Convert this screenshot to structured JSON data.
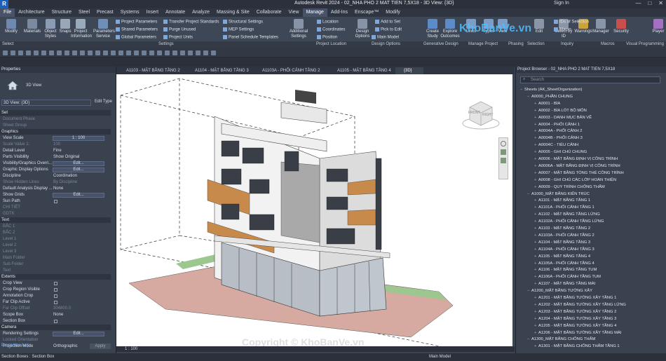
{
  "title": "Autodesk Revit 2024 - 02_NHA PHO 2 MAT TIEN 7,5X18 - 3D View: {3D}",
  "sign_in": "Sign In",
  "ribbon_tabs": [
    "File",
    "Architecture",
    "Structure",
    "Steel",
    "Precast",
    "Systems",
    "Insert",
    "Annotate",
    "Analyze",
    "Massing & Site",
    "Collaborate",
    "View",
    "Manage",
    "Add-Ins",
    "Enscape™",
    "Modify"
  ],
  "ribbon_big": [
    "Modify",
    "Materials",
    "Object Styles",
    "Snaps",
    "Project Information",
    "Parameters Service",
    "Additional Settings",
    "Design Options",
    "Create Study",
    "Explore Outcomes",
    "Links",
    "Types",
    "View",
    "Edit",
    "Select by ID",
    "Warnings",
    "Manager",
    "Security",
    "Player"
  ],
  "ribbon_small": [
    "Project Parameters",
    "Shared Parameters",
    "Global Parameters",
    "Transfer Project Standards",
    "Purge Unused",
    "Project Units",
    "Structural Settings",
    "MEP Settings",
    "Panel Schedule Templates",
    "Location",
    "Coordinates",
    "Position",
    "Add to Set",
    "Pick to Edit",
    "Main Model",
    "IDs of Selection",
    "Macro"
  ],
  "panels": [
    "Select",
    "Settings",
    "Project Location",
    "Design Options",
    "Generative Design",
    "Manage Project",
    "Phasing",
    "Selection",
    "Inquiry",
    "Macros",
    "Visual Programming"
  ],
  "props": {
    "header": "Properties",
    "type": "3D View",
    "selector": "3D View: {3D}",
    "edit_type": "Edit Type",
    "help": "Properties help",
    "apply": "Apply",
    "rows": [
      {
        "g": "Set"
      },
      {
        "k": "Document Phase",
        "v": "",
        "dim": true
      },
      {
        "k": "Sheet Group",
        "v": "",
        "dim": true
      },
      {
        "g": "Graphics"
      },
      {
        "k": "View Scale",
        "box": "1 : 100"
      },
      {
        "k": "Scale Value    1:",
        "v": "100",
        "dim": true
      },
      {
        "k": "Detail Level",
        "v": "Fine"
      },
      {
        "k": "Parts Visibility",
        "v": "Show Original"
      },
      {
        "k": "Visibility/Graphics Overri...",
        "box": "Edit..."
      },
      {
        "k": "Graphic Display Options",
        "box": "Edit..."
      },
      {
        "k": "Discipline",
        "v": "Coordination"
      },
      {
        "k": "Show Hidden Lines",
        "v": "By Discipline",
        "dim": true
      },
      {
        "k": "Default Analysis Display ...",
        "v": "None"
      },
      {
        "k": "Show Grids",
        "box": "Edit..."
      },
      {
        "k": "Sun Path",
        "cb": true
      },
      {
        "k": "CHI TIẾT",
        "v": "",
        "dim": true
      },
      {
        "k": "GDTK",
        "v": "",
        "dim": true
      },
      {
        "g": "Text"
      },
      {
        "k": "BẮC 1",
        "v": "",
        "dim": true
      },
      {
        "k": "BẮC 2",
        "v": "",
        "dim": true
      },
      {
        "k": "Level 1",
        "v": "",
        "dim": true
      },
      {
        "k": "Level 2",
        "v": "",
        "dim": true
      },
      {
        "k": "Level 3",
        "v": "",
        "dim": true
      },
      {
        "k": "Main Folder",
        "v": "",
        "dim": true
      },
      {
        "k": "Sub Folder",
        "v": "",
        "dim": true
      },
      {
        "k": "Text",
        "v": "",
        "dim": true
      },
      {
        "g": "Extents"
      },
      {
        "k": "Crop View",
        "cb": true
      },
      {
        "k": "Crop Region Visible",
        "cb": true
      },
      {
        "k": "Annotation Crop",
        "cb": true
      },
      {
        "k": "Far Clip Active",
        "cb": true
      },
      {
        "k": "Far Clip Offset",
        "v": "304800.0",
        "dim": true
      },
      {
        "k": "Scope Box",
        "v": "None"
      },
      {
        "k": "Section Box",
        "cb": true
      },
      {
        "g": "Camera"
      },
      {
        "k": "Rendering Settings",
        "box": "Edit..."
      },
      {
        "k": "Locked Orientation",
        "v": "",
        "dim": true
      },
      {
        "k": "Projection Mode",
        "v": "Orthographic"
      }
    ]
  },
  "view_tabs": [
    "A1103 - MẶT BẰNG TẦNG 2",
    "A1104 - MẶT BẰNG TẦNG 3",
    "A1103A - PHỐI CẢNH TẦNG 2",
    "A1105 - MẶT BẰNG TẦNG 4",
    "{3D}"
  ],
  "view_scale": "1 : 100",
  "browser": {
    "header": "Project Browser - 02_NHA PHO 2 MAT TIEN 7,5X18",
    "search": "Search",
    "items": [
      {
        "l": 0,
        "t": "Sheets (AK_SheetOrganization)"
      },
      {
        "l": 1,
        "t": "A0000_PHẦN CHUNG"
      },
      {
        "l": 2,
        "t": "A0001 - BÌA"
      },
      {
        "l": 2,
        "t": "A0002 - BÌA LÓT BỘ MÔN"
      },
      {
        "l": 2,
        "t": "A0003 - DANH MỤC BẢN VẼ"
      },
      {
        "l": 2,
        "t": "A0004 - PHỐI CẢNH 1"
      },
      {
        "l": 2,
        "t": "A0004A - PHỐI CẢNH 2"
      },
      {
        "l": 2,
        "t": "A0004B - PHỐI CẢNH 3"
      },
      {
        "l": 2,
        "t": "A0004C - TIỂU CẢNH"
      },
      {
        "l": 2,
        "t": "A0005 - GHI CHÚ CHUNG"
      },
      {
        "l": 2,
        "t": "A0006 - MẶT BẰNG ĐỊNH VỊ CÔNG TRÌNH"
      },
      {
        "l": 2,
        "t": "A0006A - MẶT BẰNG ĐỊNH VỊ CÔNG TRÌNH"
      },
      {
        "l": 2,
        "t": "A0007 - MẶT BẰNG TỔNG THỂ CÔNG TRÌNH"
      },
      {
        "l": 2,
        "t": "A0008 - GHI CHÚ CÁC LỚP HOÀN THIỆN"
      },
      {
        "l": 2,
        "t": "A0009 - QUY TRÌNH CHỐNG THẤM"
      },
      {
        "l": 1,
        "t": "A1000_MẶT BẰNG KIẾN TRÚC"
      },
      {
        "l": 2,
        "t": "A1101 - MẶT BẰNG TẦNG 1"
      },
      {
        "l": 2,
        "t": "A1101A - PHỐI CẢNH TẦNG 1"
      },
      {
        "l": 2,
        "t": "A1102 - MẶT BẰNG TẦNG LỬNG"
      },
      {
        "l": 2,
        "t": "A1102A - PHỐI CẢNH TẦNG LỬNG"
      },
      {
        "l": 2,
        "t": "A1103 - MẶT BẰNG TẦNG 2"
      },
      {
        "l": 2,
        "t": "A1103A - PHỐI CẢNH TẦNG 2"
      },
      {
        "l": 2,
        "t": "A1104 - MẶT BẰNG TẦNG 3"
      },
      {
        "l": 2,
        "t": "A1104A - PHỐI CẢNH TẦNG 3"
      },
      {
        "l": 2,
        "t": "A1105 - MẶT BẰNG TẦNG 4"
      },
      {
        "l": 2,
        "t": "A1105A - PHỐI CẢNH TẦNG 4"
      },
      {
        "l": 2,
        "t": "A1106 - MẶT BẰNG TẦNG TUM"
      },
      {
        "l": 2,
        "t": "A1106A - PHỐI CẢNH TẦNG TUM"
      },
      {
        "l": 2,
        "t": "A1107 - MẶT BẰNG TẦNG MÁI"
      },
      {
        "l": 1,
        "t": "A1200_MẶT BẰNG TƯỜNG XÂY"
      },
      {
        "l": 2,
        "t": "A1201 - MẶT BẰNG TƯỜNG XÂY TẦNG 1"
      },
      {
        "l": 2,
        "t": "A1202 - MẶT BẰNG TƯỜNG XÂY TẦNG LỬNG"
      },
      {
        "l": 2,
        "t": "A1203 - MẶT BẰNG TƯỜNG XÂY TẦNG 2"
      },
      {
        "l": 2,
        "t": "A1204 - MẶT BẰNG TƯỜNG XÂY TẦNG 3"
      },
      {
        "l": 2,
        "t": "A1205 - MẶT BẰNG TƯỜNG XÂY TẦNG 4"
      },
      {
        "l": 2,
        "t": "A1206 - MẶT BẰNG TƯỜNG XÂY TẦNG MÁI"
      },
      {
        "l": 1,
        "t": "A1300_MẶT BẰNG CHỐNG THẤM"
      },
      {
        "l": 2,
        "t": "A1301 - MẶT BẰNG CHỐNG THẤM TẦNG 1"
      }
    ]
  },
  "viewcube": {
    "front": "FRONT",
    "right": "RIGHT"
  },
  "status_left": "Section Boxes : Section Box",
  "status_model": "Main Model",
  "watermark_logo": "KhoBanVe.vn",
  "watermark_bottom": "Copyright © KhoBanVe.vn"
}
